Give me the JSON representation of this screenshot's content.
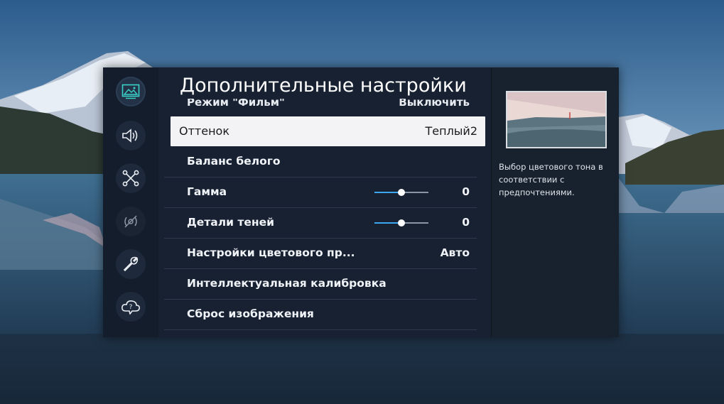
{
  "menu": {
    "title": "Дополнительные настройки",
    "partial_item": {
      "label": "Режим \"Фильм\"",
      "value": "Выключить"
    },
    "items": [
      {
        "label": "Оттенок",
        "value": "Теплый2",
        "focused": true
      },
      {
        "label": "Баланс белого",
        "value": ""
      },
      {
        "label": "Гамма",
        "value": "0",
        "slider": 0.5
      },
      {
        "label": "Детали теней",
        "value": "0",
        "slider": 0.5
      },
      {
        "label": "Настройки цветового пр...",
        "value": "Авто"
      },
      {
        "label": "Интеллектуальная калибровка",
        "value": ""
      },
      {
        "label": "Сброс изображения",
        "value": ""
      }
    ]
  },
  "sidebar": {
    "items": [
      {
        "name": "picture-icon",
        "active": true
      },
      {
        "name": "sound-icon"
      },
      {
        "name": "connection-icon"
      },
      {
        "name": "broadcast-icon"
      },
      {
        "name": "support-wrench-icon"
      },
      {
        "name": "cloud-help-icon"
      }
    ]
  },
  "info_panel": {
    "description": "Выбор цветового тона в соответствии с предпочтениями."
  },
  "colors": {
    "panel": "#172131",
    "focus_row": "#f3f3f5",
    "slider_fill": "#3ea6f0"
  }
}
